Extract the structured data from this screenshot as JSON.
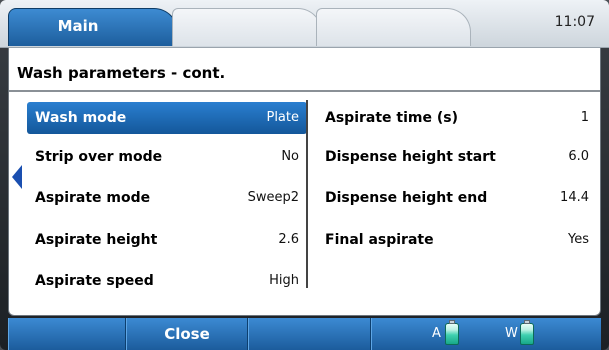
{
  "tabs": [
    {
      "label": "Main",
      "active": true
    },
    {
      "label": ""
    },
    {
      "label": ""
    }
  ],
  "clock": "11:07",
  "page_title": "Wash parameters - cont.",
  "left_params": [
    {
      "label": "Wash mode",
      "value": "Plate",
      "selected": true
    },
    {
      "label": "Strip over mode",
      "value": "No"
    },
    {
      "label": "Aspirate mode",
      "value": "Sweep2"
    },
    {
      "label": "Aspirate height",
      "value": "2.6"
    },
    {
      "label": "Aspirate speed",
      "value": "High"
    }
  ],
  "right_params": [
    {
      "label": "Aspirate time (s)",
      "value": "1"
    },
    {
      "label": "Dispense height start",
      "value": "6.0"
    },
    {
      "label": "Dispense height end",
      "value": "14.4"
    },
    {
      "label": "Final aspirate",
      "value": "Yes"
    }
  ],
  "bottom_bar": {
    "close_label": "Close",
    "bottle_a_label": "A",
    "bottle_w_label": "W"
  },
  "colors": {
    "accent": "#1d5e9d",
    "selected_row": "#1f6bb6",
    "bottle_liquid": "#3fd0b0"
  },
  "icons": [
    "scroll-left-marker-icon",
    "bottle-a-icon",
    "bottle-w-icon"
  ]
}
